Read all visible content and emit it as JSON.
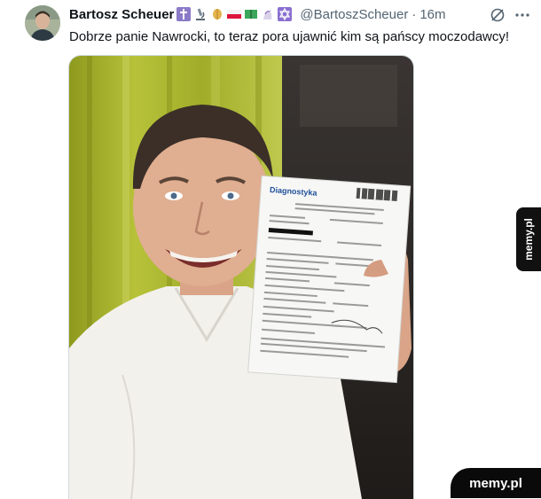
{
  "tweet": {
    "display_name": "Bartosz Scheuer",
    "handle": "@BartoszScheuer",
    "separator": "·",
    "time": "16m",
    "text": "Dobrze panie Nawrocki, to teraz pora ujawnić kim są pańscy moczodawcy!",
    "name_emojis": [
      "cross-emoji",
      "microscope-emoji",
      "wheat-emoji",
      "poland-flag-emoji",
      "book-emoji",
      "unicorn-emoji",
      "star-of-david-emoji"
    ]
  },
  "media": {
    "document_logo": "Diagnostyka"
  },
  "watermarks": {
    "side": "memy.pl",
    "corner": "memy.pl"
  },
  "colors": {
    "text_primary": "#0f1419",
    "text_secondary": "#536471",
    "curtain": "#a8b52c",
    "shirt": "#f3f1ec",
    "document": "#f7f7f5"
  }
}
